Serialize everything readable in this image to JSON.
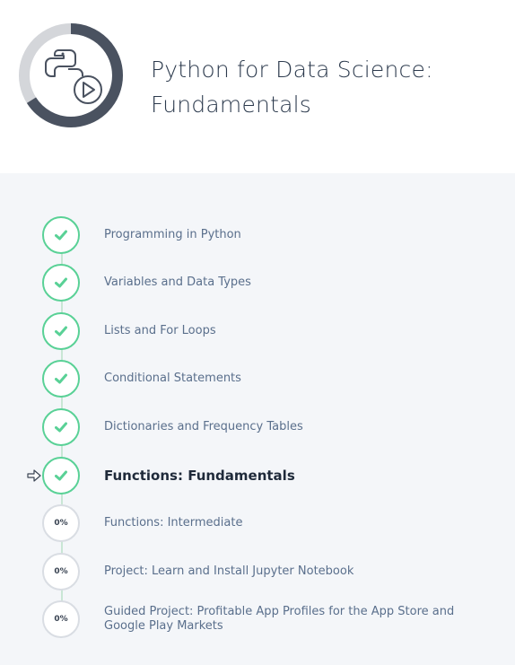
{
  "course": {
    "title_line1": "Python for Data Science:",
    "title_line2": "Fundamentals",
    "progress": 0.66,
    "icon": "python-play-icon"
  },
  "colors": {
    "complete": "#59d196",
    "incomplete": "#d9dde3",
    "ring_progress": "#4a5260",
    "ring_track": "#d4d6da"
  },
  "steps": [
    {
      "label": "Programming in Python",
      "status": "complete"
    },
    {
      "label": "Variables and Data Types",
      "status": "complete"
    },
    {
      "label": "Lists and For Loops",
      "status": "complete"
    },
    {
      "label": "Conditional Statements",
      "status": "complete"
    },
    {
      "label": "Dictionaries and Frequency Tables",
      "status": "complete"
    },
    {
      "label": "Functions: Fundamentals",
      "status": "complete",
      "current": true
    },
    {
      "label": "Functions: Intermediate",
      "status": "incomplete",
      "progress": "0%"
    },
    {
      "label": "Project: Learn and Install Jupyter Notebook",
      "status": "incomplete",
      "progress": "0%"
    },
    {
      "label": "Guided Project: Profitable App Profiles for the App Store and Google Play Markets",
      "status": "incomplete",
      "progress": "0%"
    }
  ]
}
